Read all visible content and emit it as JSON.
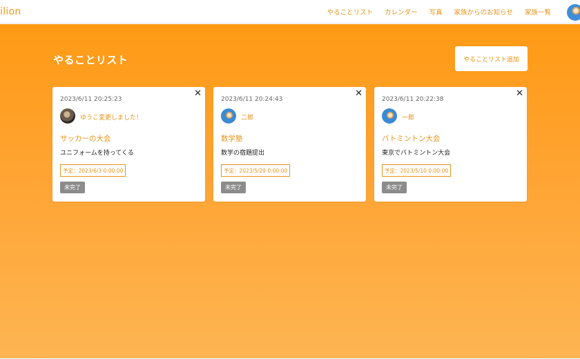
{
  "app": {
    "brand": "ilion"
  },
  "nav": {
    "links": [
      "やることリスト",
      "カレンダー",
      "写真",
      "家族からのお知らせ",
      "家族一覧"
    ]
  },
  "page": {
    "title": "やることリスト",
    "add_button_label": "やることリスト追加"
  },
  "cards": [
    {
      "close": "✕",
      "date": "2023/6/11 20:25:23",
      "avatar": "photo-avatar",
      "user": "ゆうこ変更しました！",
      "title": "サッカーの大会",
      "description": "ユニフォームを持ってくる",
      "due": "予定：2023/6/3 0:00:00",
      "status": "未完了"
    },
    {
      "close": "✕",
      "date": "2023/6/11 20:24:43",
      "avatar": "beach-avatar",
      "user": "二郎",
      "title": "数学塾",
      "description": "数学の宿題提出",
      "due": "予定：2023/5/29 0:00:00",
      "status": "未完了"
    },
    {
      "close": "✕",
      "date": "2023/6/11 20:22:38",
      "avatar": "beach-avatar",
      "user": "一郎",
      "title": "バトミントン大会",
      "description": "東京でバトミントン大会",
      "due": "予定：2023/5/10 0:00:00",
      "status": "未完了"
    }
  ],
  "colors": {
    "accent": "#e89418",
    "hero_top": "#ff9a14",
    "hero_bottom": "#fdb552",
    "status_badge": "#8c8c8c"
  }
}
